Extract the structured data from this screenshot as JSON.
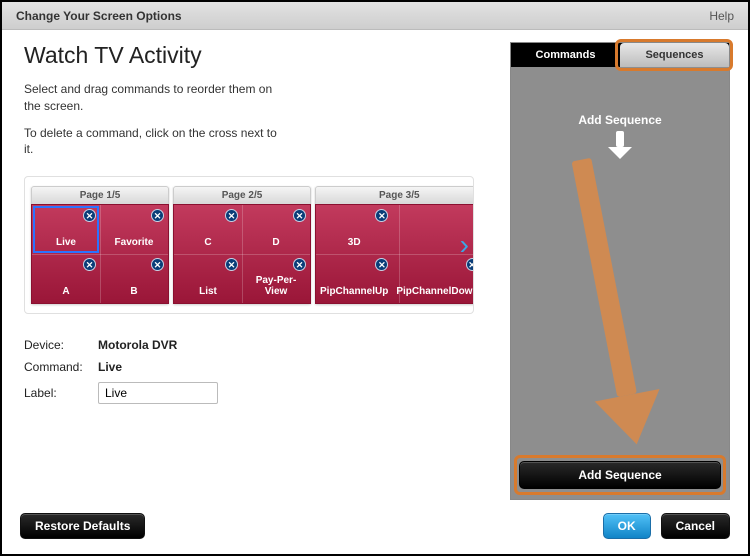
{
  "window": {
    "title": "Change Your Screen Options",
    "help": "Help"
  },
  "heading": "Watch TV Activity",
  "instructions": {
    "line1": "Select and drag commands to reorder them on the screen.",
    "line2": "To delete a command, click on the cross next to it."
  },
  "pages": [
    {
      "label": "Page 1/5",
      "buttons": [
        "Live",
        "Favorite",
        "A",
        "B"
      ],
      "selected": 0
    },
    {
      "label": "Page 2/5",
      "buttons": [
        "C",
        "D",
        "List",
        "Pay-Per-View"
      ]
    },
    {
      "label": "Page 3/5",
      "buttons": [
        "3D",
        "",
        "PipChannelUp",
        "PipChannelDown"
      ]
    }
  ],
  "detail": {
    "device_label": "Device:",
    "device_value": "Motorola DVR",
    "command_label": "Command:",
    "command_value": "Live",
    "label_label": "Label:",
    "label_value": "Live"
  },
  "panel": {
    "tabs": {
      "commands": "Commands",
      "sequences": "Sequences"
    },
    "add_sequence_hint": "Add Sequence",
    "add_sequence_button": "Add Sequence"
  },
  "footer": {
    "restore": "Restore Defaults",
    "ok": "OK",
    "cancel": "Cancel"
  }
}
